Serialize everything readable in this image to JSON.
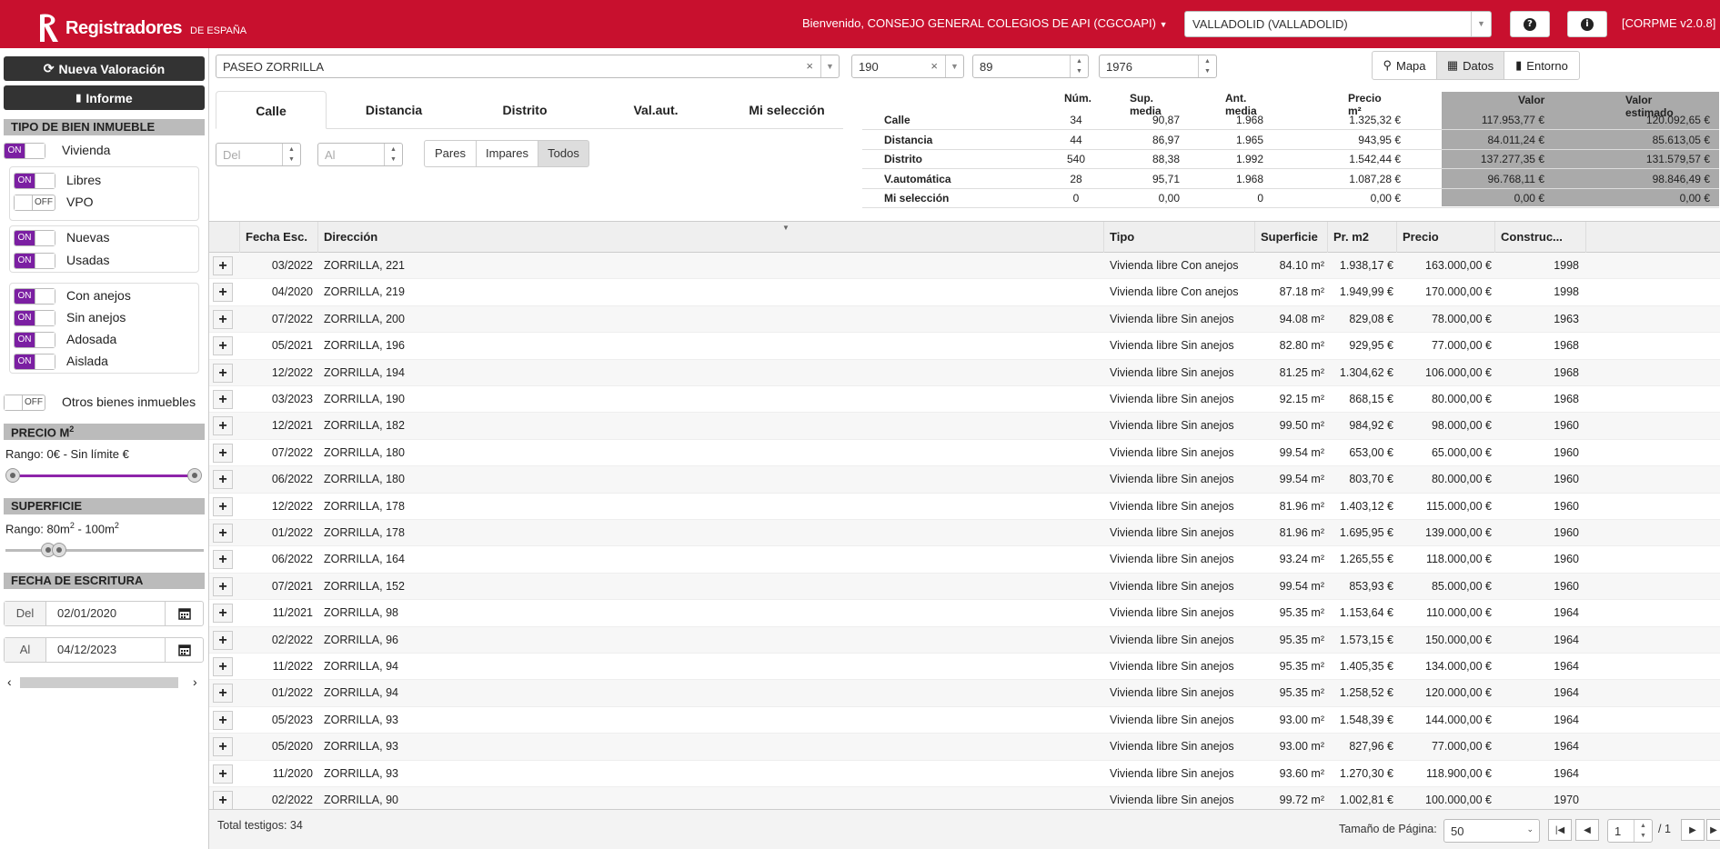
{
  "header": {
    "logo_main": "Registradores",
    "logo_sub": "DE ESPAÑA",
    "welcome_prefix": "Bienvenido,",
    "welcome_user": "CONSEJO GENERAL COLEGIOS DE API (CGCOAPI)",
    "location": "VALLADOLID (VALLADOLID)",
    "version": "[CORPME v2.0.8]",
    "brand_color": "#c8102e"
  },
  "sidebar": {
    "new_valuation": "Nueva Valoración",
    "report": "Informe",
    "tipo_title": "TIPO DE BIEN INMUEBLE",
    "vivienda": {
      "state": "ON",
      "label": "Vivienda"
    },
    "libres": {
      "state": "ON",
      "label": "Libres"
    },
    "vpo": {
      "state": "OFF",
      "label": "VPO"
    },
    "nuevas": {
      "state": "ON",
      "label": "Nuevas"
    },
    "usadas": {
      "state": "ON",
      "label": "Usadas"
    },
    "con_anejos": {
      "state": "ON",
      "label": "Con anejos"
    },
    "sin_anejos": {
      "state": "ON",
      "label": "Sin anejos"
    },
    "adosada": {
      "state": "ON",
      "label": "Adosada"
    },
    "aislada": {
      "state": "ON",
      "label": "Aislada"
    },
    "otros": {
      "state": "OFF",
      "label": "Otros bienes inmuebles"
    },
    "precio_title": "PRECIO M",
    "precio_sup": "2",
    "precio_range": "Rango: 0€ - Sin límite €",
    "sup_title": "SUPERFICIE",
    "sup_range_prefix": "Rango: 80m",
    "sup_range_mid": " - 100m",
    "sup_unit_sup": "2",
    "fecha_title": "FECHA DE ESCRITURA",
    "del_label": "Del",
    "del_value": "02/01/2020",
    "al_label": "Al",
    "al_value": "04/12/2023",
    "accent": "#7b1fa2"
  },
  "search": {
    "street": "PASEO ZORRILLA",
    "number": "190",
    "field3": "89",
    "field4": "1976"
  },
  "view_buttons": {
    "map": "Mapa",
    "data": "Datos",
    "environment": "Entorno"
  },
  "tabs": [
    "Calle",
    "Distancia",
    "Distrito",
    "Val.aut.",
    "Mi selección"
  ],
  "filters": {
    "del_placeholder": "Del",
    "al_placeholder": "Al",
    "pares": "Pares",
    "impares": "Impares",
    "todos": "Todos"
  },
  "stats": {
    "headers": [
      "Núm.",
      "Sup. media",
      "Ant. media",
      "Precio m²",
      "Valor",
      "Valor estimado"
    ],
    "rows": [
      [
        "Calle",
        "34",
        "90,87",
        "1.968",
        "1.325,32 €",
        "117.953,77 €",
        "120.092,65 €"
      ],
      [
        "Distancia",
        "44",
        "86,97",
        "1.965",
        "943,95 €",
        "84.011,24 €",
        "85.613,05 €"
      ],
      [
        "Distrito",
        "540",
        "88,38",
        "1.992",
        "1.542,44 €",
        "137.277,35 €",
        "131.579,57 €"
      ],
      [
        "V.automática",
        "28",
        "95,71",
        "1.968",
        "1.087,28 €",
        "96.768,11 €",
        "98.846,49 €"
      ],
      [
        "Mi selección",
        "0",
        "0,00",
        "0",
        "0,00 €",
        "0,00 €",
        "0,00 €"
      ]
    ]
  },
  "grid": {
    "columns": [
      "Fecha Esc.",
      "Dirección",
      "Tipo",
      "Superficie",
      "Pr. m2",
      "Precio",
      "Construc..."
    ],
    "rows": [
      [
        "03/2022",
        "ZORRILLA, 221",
        "Vivienda libre Con anejos",
        "84.10 m²",
        "1.938,17 €",
        "163.000,00 €",
        "1998"
      ],
      [
        "04/2020",
        "ZORRILLA, 219",
        "Vivienda libre Con anejos",
        "87.18 m²",
        "1.949,99 €",
        "170.000,00 €",
        "1998"
      ],
      [
        "07/2022",
        "ZORRILLA, 200",
        "Vivienda libre Sin anejos",
        "94.08 m²",
        "829,08 €",
        "78.000,00 €",
        "1963"
      ],
      [
        "05/2021",
        "ZORRILLA, 196",
        "Vivienda libre Sin anejos",
        "82.80 m²",
        "929,95 €",
        "77.000,00 €",
        "1968"
      ],
      [
        "12/2022",
        "ZORRILLA, 194",
        "Vivienda libre Sin anejos",
        "81.25 m²",
        "1.304,62 €",
        "106.000,00 €",
        "1968"
      ],
      [
        "03/2023",
        "ZORRILLA, 190",
        "Vivienda libre Sin anejos",
        "92.15 m²",
        "868,15 €",
        "80.000,00 €",
        "1968"
      ],
      [
        "12/2021",
        "ZORRILLA, 182",
        "Vivienda libre Sin anejos",
        "99.50 m²",
        "984,92 €",
        "98.000,00 €",
        "1960"
      ],
      [
        "07/2022",
        "ZORRILLA, 180",
        "Vivienda libre Sin anejos",
        "99.54 m²",
        "653,00 €",
        "65.000,00 €",
        "1960"
      ],
      [
        "06/2022",
        "ZORRILLA, 180",
        "Vivienda libre Sin anejos",
        "99.54 m²",
        "803,70 €",
        "80.000,00 €",
        "1960"
      ],
      [
        "12/2022",
        "ZORRILLA, 178",
        "Vivienda libre Sin anejos",
        "81.96 m²",
        "1.403,12 €",
        "115.000,00 €",
        "1960"
      ],
      [
        "01/2022",
        "ZORRILLA, 178",
        "Vivienda libre Sin anejos",
        "81.96 m²",
        "1.695,95 €",
        "139.000,00 €",
        "1960"
      ],
      [
        "06/2022",
        "ZORRILLA, 164",
        "Vivienda libre Sin anejos",
        "93.24 m²",
        "1.265,55 €",
        "118.000,00 €",
        "1960"
      ],
      [
        "07/2021",
        "ZORRILLA, 152",
        "Vivienda libre Sin anejos",
        "99.54 m²",
        "853,93 €",
        "85.000,00 €",
        "1960"
      ],
      [
        "11/2021",
        "ZORRILLA, 98",
        "Vivienda libre Sin anejos",
        "95.35 m²",
        "1.153,64 €",
        "110.000,00 €",
        "1964"
      ],
      [
        "02/2022",
        "ZORRILLA, 96",
        "Vivienda libre Sin anejos",
        "95.35 m²",
        "1.573,15 €",
        "150.000,00 €",
        "1964"
      ],
      [
        "11/2022",
        "ZORRILLA, 94",
        "Vivienda libre Sin anejos",
        "95.35 m²",
        "1.405,35 €",
        "134.000,00 €",
        "1964"
      ],
      [
        "01/2022",
        "ZORRILLA, 94",
        "Vivienda libre Sin anejos",
        "95.35 m²",
        "1.258,52 €",
        "120.000,00 €",
        "1964"
      ],
      [
        "05/2023",
        "ZORRILLA, 93",
        "Vivienda libre Sin anejos",
        "93.00 m²",
        "1.548,39 €",
        "144.000,00 €",
        "1964"
      ],
      [
        "05/2020",
        "ZORRILLA, 93",
        "Vivienda libre Sin anejos",
        "93.00 m²",
        "827,96 €",
        "77.000,00 €",
        "1964"
      ],
      [
        "11/2020",
        "ZORRILLA, 93",
        "Vivienda libre Sin anejos",
        "93.60 m²",
        "1.270,30 €",
        "118.900,00 €",
        "1964"
      ],
      [
        "02/2022",
        "ZORRILLA, 90",
        "Vivienda libre Sin anejos",
        "99.72 m²",
        "1.002,81 €",
        "100.000,00 €",
        "1970"
      ]
    ]
  },
  "footer": {
    "total": "Total testigos: 34",
    "page_size_label": "Tamaño de Página:",
    "page_size": "50",
    "page": "1",
    "of_pages": "/ 1"
  }
}
